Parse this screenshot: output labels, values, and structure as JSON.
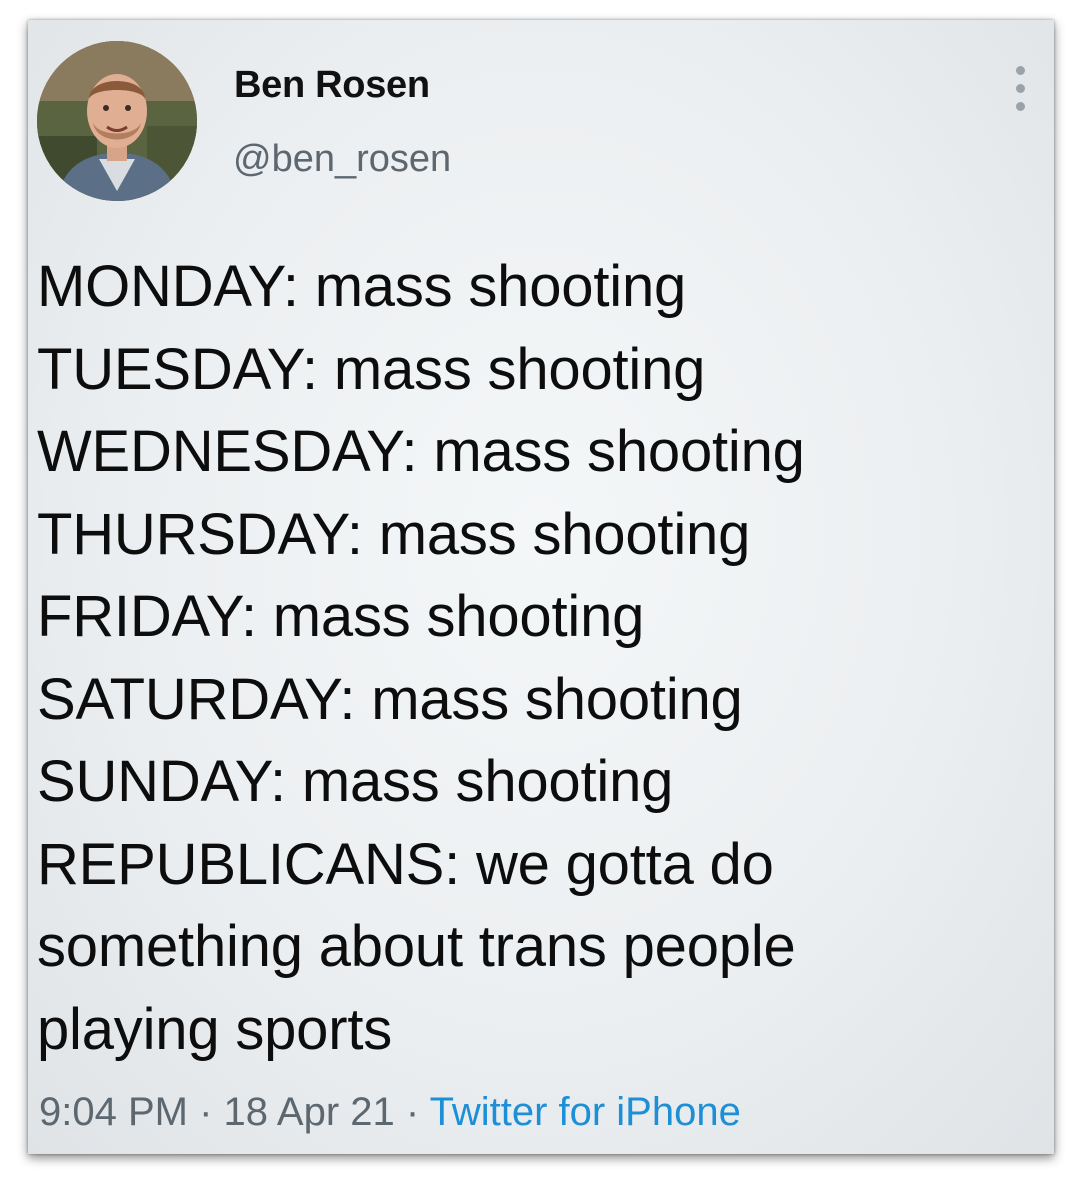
{
  "tweet": {
    "author": {
      "name": "Ben Rosen",
      "handle": "@ben_rosen",
      "avatar": "profile-photo"
    },
    "more_icon": "more-vertical-icon",
    "lines": [
      "MONDAY: mass shooting",
      "TUESDAY: mass shooting",
      "WEDNESDAY: mass shooting",
      "THURSDAY: mass shooting",
      "FRIDAY: mass shooting",
      "SATURDAY: mass shooting",
      "SUNDAY: mass shooting",
      "REPUBLICANS: we gotta do",
      "something about trans people",
      "playing sports"
    ],
    "meta": {
      "time": "9:04 PM",
      "separator": " · ",
      "date": "18 Apr 21",
      "source": "Twitter for iPhone"
    },
    "colors": {
      "text": "#0d0d0d",
      "secondary": "#5c6770",
      "link": "#1d8fd6"
    }
  }
}
